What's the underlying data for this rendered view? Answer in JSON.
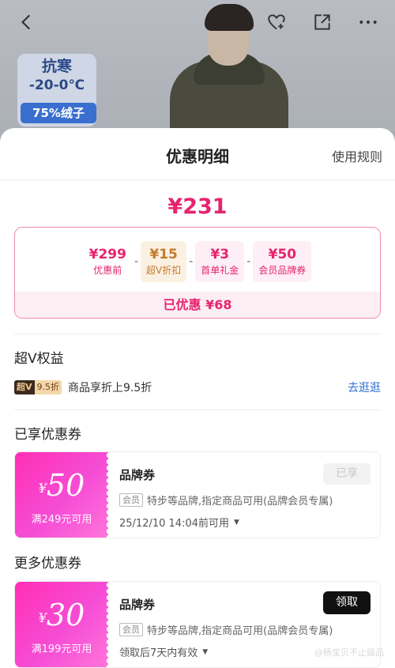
{
  "backdrop": {
    "badge_line1": "抗寒",
    "badge_line2": "-20-0℃",
    "badge_tag": "75%绒子"
  },
  "top_bar": {
    "icons": [
      "back-icon",
      "heart-add-icon",
      "share-icon",
      "more-icon"
    ]
  },
  "sheet": {
    "title": "优惠明细",
    "rules_link": "使用规则"
  },
  "price": {
    "final": "¥231",
    "breakdown": [
      {
        "amount": "¥299",
        "label": "优惠前",
        "style": "plain"
      },
      {
        "amount": "¥15",
        "label": "超V折扣",
        "style": "vip"
      },
      {
        "amount": "¥3",
        "label": "首单礼金",
        "style": "pink"
      },
      {
        "amount": "¥50",
        "label": "会员品牌券",
        "style": "pink"
      }
    ],
    "operator": "-",
    "saved": "已优惠 ¥68"
  },
  "super_v": {
    "section_title": "超V权益",
    "tag_left": "超V",
    "tag_right": "9.5折",
    "desc": "商品享折上9.5折",
    "link": "去逛逛"
  },
  "used_coupons": {
    "section_title": "已享优惠券",
    "items": [
      {
        "currency": "¥",
        "value": "50",
        "condition": "满249元可用",
        "name": "品牌券",
        "member_tag": "会员",
        "desc": "特步等品牌,指定商品可用(品牌会员专属)",
        "expiry": "25/12/10 14:04前可用",
        "button": "已享"
      }
    ]
  },
  "more_coupons": {
    "section_title": "更多优惠券",
    "items": [
      {
        "currency": "¥",
        "value": "30",
        "condition": "满199元可用",
        "name": "品牌券",
        "member_tag": "会员",
        "desc": "特步等品牌,指定商品可用(品牌会员专属)",
        "expiry": "领取后7天内有效",
        "button": "领取"
      }
    ]
  },
  "watermark": "@杨宝贝不止级品",
  "colors": {
    "accent": "#e6246e",
    "vip": "#c57a2c",
    "link": "#2f6fd6"
  }
}
